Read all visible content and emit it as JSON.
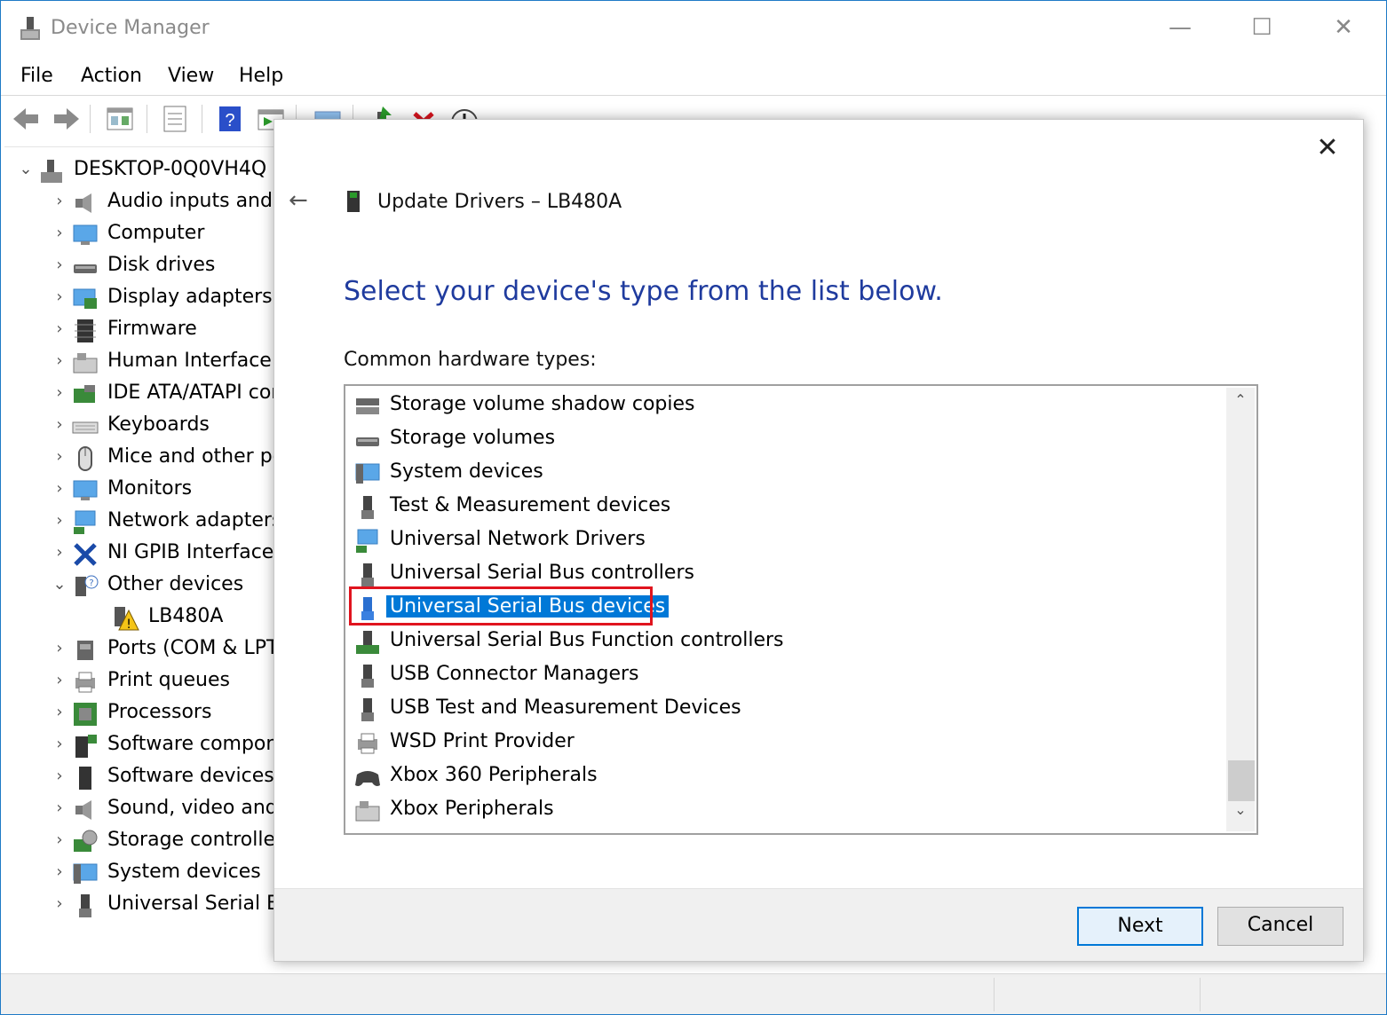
{
  "window": {
    "title": "Device Manager",
    "controls": {
      "minimize": "—",
      "maximize": "☐",
      "close": "✕"
    }
  },
  "menu": [
    "File",
    "Action",
    "View",
    "Help"
  ],
  "toolbar": {
    "icons": [
      "back-arrow-icon",
      "forward-arrow-icon",
      "show-hide-console-tree-icon",
      "properties-icon",
      "help-icon",
      "run-action-icon",
      "monitor-icon",
      "update-driver-icon",
      "uninstall-device-icon",
      "disable-device-icon"
    ]
  },
  "tree": {
    "root": "DESKTOP-0Q0VH4Q",
    "items": [
      {
        "label": "Audio inputs and outputs",
        "icon": "speaker-icon",
        "expanded": false
      },
      {
        "label": "Computer",
        "icon": "computer-icon",
        "expanded": false
      },
      {
        "label": "Disk drives",
        "icon": "disk-drive-icon",
        "expanded": false
      },
      {
        "label": "Display adapters",
        "icon": "display-adapter-icon",
        "expanded": false
      },
      {
        "label": "Firmware",
        "icon": "chip-icon",
        "expanded": false
      },
      {
        "label": "Human Interface Devices",
        "icon": "hid-icon",
        "expanded": false
      },
      {
        "label": "IDE ATA/ATAPI controllers",
        "icon": "ide-controller-icon",
        "expanded": false
      },
      {
        "label": "Keyboards",
        "icon": "keyboard-icon",
        "expanded": false
      },
      {
        "label": "Mice and other pointing devices",
        "icon": "mouse-icon",
        "expanded": false
      },
      {
        "label": "Monitors",
        "icon": "monitor-icon",
        "expanded": false
      },
      {
        "label": "Network adapters",
        "icon": "network-adapter-icon",
        "expanded": false
      },
      {
        "label": "NI GPIB Interfaces",
        "icon": "ni-gpib-icon",
        "expanded": false
      },
      {
        "label": "Other devices",
        "icon": "unknown-device-icon",
        "expanded": true
      },
      {
        "label": "LB480A",
        "icon": "warning-device-icon",
        "child": true
      },
      {
        "label": "Ports (COM & LPT)",
        "icon": "port-icon",
        "expanded": false
      },
      {
        "label": "Print queues",
        "icon": "printer-icon",
        "expanded": false
      },
      {
        "label": "Processors",
        "icon": "processor-icon",
        "expanded": false
      },
      {
        "label": "Software components",
        "icon": "software-component-icon",
        "expanded": false
      },
      {
        "label": "Software devices",
        "icon": "software-device-icon",
        "expanded": false
      },
      {
        "label": "Sound, video and game controllers",
        "icon": "sound-icon",
        "expanded": false
      },
      {
        "label": "Storage controllers",
        "icon": "storage-controller-icon",
        "expanded": false
      },
      {
        "label": "System devices",
        "icon": "system-device-icon",
        "expanded": false
      },
      {
        "label": "Universal Serial Bus controllers",
        "icon": "usb-icon",
        "expanded": false
      }
    ]
  },
  "dialog": {
    "close": "✕",
    "back": "←",
    "title": "Update Drivers – LB480A",
    "heading": "Select your device's type from the list below.",
    "list_label": "Common hardware types:",
    "list": [
      {
        "label": "Storage volume shadow copies",
        "icon": "storage-volume-icon"
      },
      {
        "label": "Storage volumes",
        "icon": "disk-drive-icon"
      },
      {
        "label": "System devices",
        "icon": "system-device-icon"
      },
      {
        "label": "Test & Measurement devices",
        "icon": "usb-plug-icon"
      },
      {
        "label": "Universal Network Drivers",
        "icon": "network-icon"
      },
      {
        "label": "Universal Serial Bus controllers",
        "icon": "usb-plug-icon"
      },
      {
        "label": "Universal Serial Bus devices",
        "icon": "usb-device-icon",
        "selected": true
      },
      {
        "label": "Universal Serial Bus Function controllers",
        "icon": "usb-function-icon"
      },
      {
        "label": "USB Connector Managers",
        "icon": "usb-plug-icon"
      },
      {
        "label": "USB Test and Measurement Devices",
        "icon": "usb-plug-icon"
      },
      {
        "label": "WSD Print Provider",
        "icon": "printer-icon"
      },
      {
        "label": "Xbox 360 Peripherals",
        "icon": "gamepad-icon"
      },
      {
        "label": "Xbox Peripherals",
        "icon": "hid-icon"
      }
    ],
    "buttons": {
      "next": "Next",
      "cancel": "Cancel"
    }
  },
  "colors": {
    "heading": "#1f3b9e",
    "selection": "#0078d7",
    "highlight_box": "#e0141e"
  }
}
